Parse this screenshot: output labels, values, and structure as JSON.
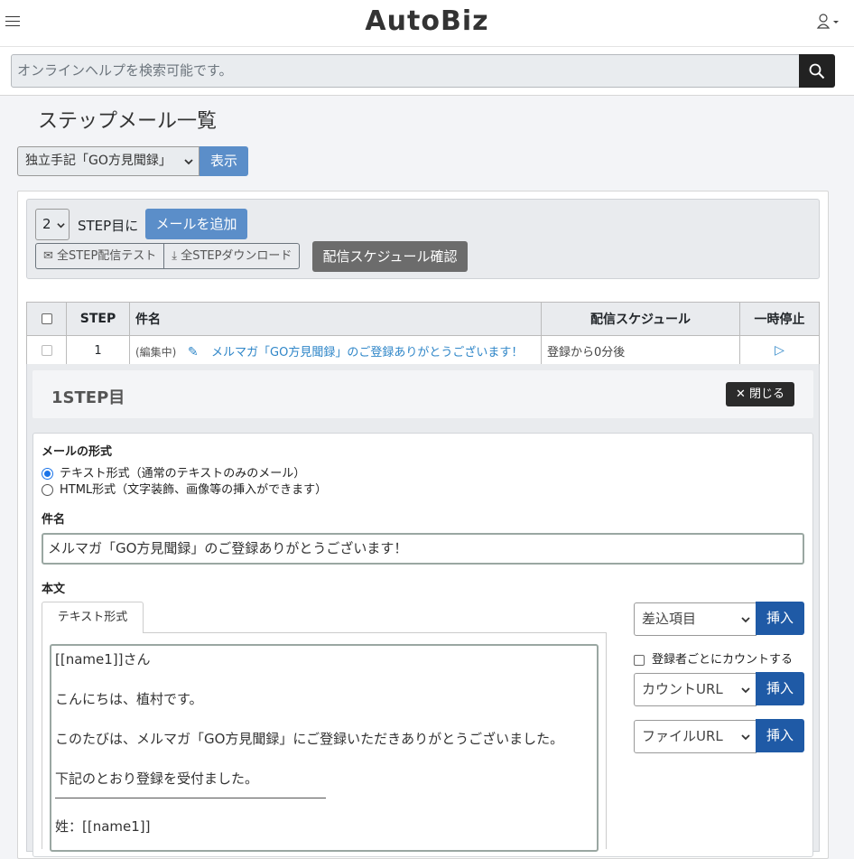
{
  "header": {
    "logo": "AutoBiz",
    "search_placeholder": "オンラインヘルプを検索可能です。"
  },
  "page": {
    "title": "ステップメール一覧",
    "scenario_selected": "独立手記「GO方見聞録」",
    "show_label": "表示"
  },
  "toolbar": {
    "step_value": "2",
    "step_suffix": "STEP目に",
    "add_mail_label": "メールを追加",
    "test_all_label": "全STEP配信テスト",
    "download_all_label": "全STEPダウンロード",
    "schedule_label": "配信スケジュール確認"
  },
  "table": {
    "headers": [
      "",
      "STEP",
      "件名",
      "配信スケジュール",
      "一時停止"
    ],
    "rows": [
      {
        "step": "1",
        "status": "(編集中)",
        "subject": "メルマガ「GO方見聞録」のご登録ありがとうございます！",
        "schedule": "登録から0分後",
        "pause": "▷"
      }
    ]
  },
  "detail": {
    "title": "1STEP目",
    "close_label": "閉じる",
    "format_label": "メールの形式",
    "format_options": [
      "テキスト形式（通常のテキストのみのメール）",
      "HTML形式（文字装飾、画像等の挿入ができます）"
    ],
    "format_selected_index": 0,
    "subject_label": "件名",
    "subject_value": "メルマガ「GO方見聞録」のご登録ありがとうございます！",
    "body_label": "本文",
    "body_tab": "テキスト形式",
    "body_lines": [
      "[[name1]]さん",
      "こんにちは、植村です。",
      "このたびは、メルマガ「GO方見聞録」にご登録いただきありがとうございました。",
      "下記のとおり登録を受付ました。",
      "姓：[[name1]]"
    ],
    "insert_field_select": "差込項目",
    "insert_label": "挿入",
    "count_checkbox_label": "登録者ごとにカウントする",
    "count_url_select": "カウントURL",
    "file_url_select": "ファイルURL"
  },
  "colors": {
    "primary": "#5b8ec9",
    "insert": "#1f5aa6",
    "link": "#2f86c8"
  }
}
